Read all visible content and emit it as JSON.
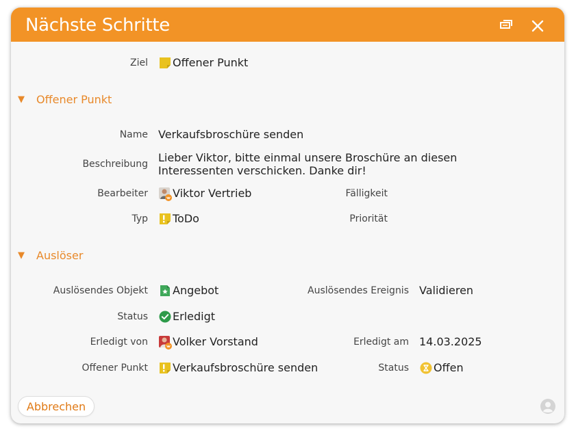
{
  "dialog": {
    "title": "Nächste Schritte",
    "restore_icon": "restore-window-icon",
    "close_icon": "close-icon"
  },
  "target": {
    "label": "Ziel",
    "value": "Offener Punkt",
    "icon": "note-icon"
  },
  "sections": {
    "open_item": "Offener Punkt",
    "trigger": "Auslöser"
  },
  "open_item": {
    "name_label": "Name",
    "name_value": "Verkaufsbroschüre senden",
    "description_label": "Beschreibung",
    "description_value": "Lieber Viktor, bitte einmal unsere Broschüre an diesen Interessenten verschicken. Danke dir!",
    "editor_label": "Bearbeiter",
    "editor_value": "Viktor Vertrieb",
    "due_label": "Fälligkeit",
    "due_value": "",
    "type_label": "Typ",
    "type_value": "ToDo",
    "priority_label": "Priorität",
    "priority_value": ""
  },
  "trigger": {
    "object_label": "Auslösendes Objekt",
    "object_value": "Angebot",
    "event_label": "Auslösendes Ereignis",
    "event_value": "Validieren",
    "status_label": "Status",
    "status_value": "Erledigt",
    "done_by_label": "Erledigt von",
    "done_by_value": "Volker Vorstand",
    "done_at_label": "Erledigt am",
    "done_at_value": "14.03.2025",
    "open_item_label": "Offener Punkt",
    "open_item_value": "Verkaufsbroschüre senden",
    "open_item_status_label": "Status",
    "open_item_status_value": "Offen"
  },
  "footer": {
    "cancel_label": "Abbrechen",
    "user_icon": "user-icon"
  },
  "colors": {
    "accent": "#f29326",
    "section_text": "#e8892a",
    "done_green": "#2e9b4a",
    "open_yellow": "#f1c232"
  }
}
